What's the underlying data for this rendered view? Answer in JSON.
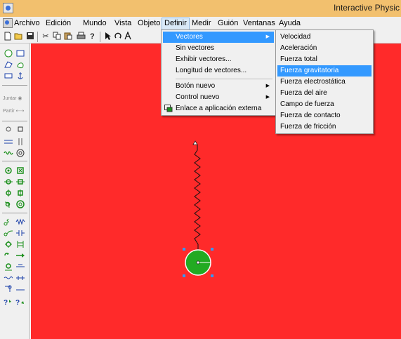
{
  "window": {
    "title": "Interactive Physic"
  },
  "menubar": {
    "items": [
      "Archivo",
      "Edición",
      "Mundo",
      "Vista",
      "Objeto",
      "Definir",
      "Medir",
      "Guión",
      "Ventanas",
      "Ayuda"
    ],
    "active": "Definir"
  },
  "definir_menu": {
    "items": [
      "Vectores",
      "Sin vectores",
      "Exhibir vectores...",
      "Longitud de vectores...",
      "Botón nuevo",
      "Control nuevo",
      "Enlace a aplicación externa"
    ],
    "highlighted": "Vectores"
  },
  "vectores_submenu": {
    "items": [
      "Velocidad",
      "Aceleración",
      "Fuerza total",
      "Fuerza gravitatoria",
      "Fuerza electrostática",
      "Fuerza del aire",
      "Campo de fuerza",
      "Fuerza de contacto",
      "Fuerza de fricción"
    ],
    "highlighted": "Fuerza gravitatoria"
  },
  "palette": {
    "join_label": "Juntar",
    "split_label": "Partir"
  },
  "colors": {
    "workspace": "#ff2a2a",
    "ball": "#22aa22",
    "selection": "#3399ff",
    "titlebar": "#f2c06e"
  },
  "icons": [
    "new-icon",
    "open-icon",
    "save-icon",
    "cut-icon",
    "copy-icon",
    "paste-icon",
    "print-icon",
    "help-icon",
    "arrow-tool-icon",
    "rotate-tool-icon",
    "text-tool-icon"
  ]
}
